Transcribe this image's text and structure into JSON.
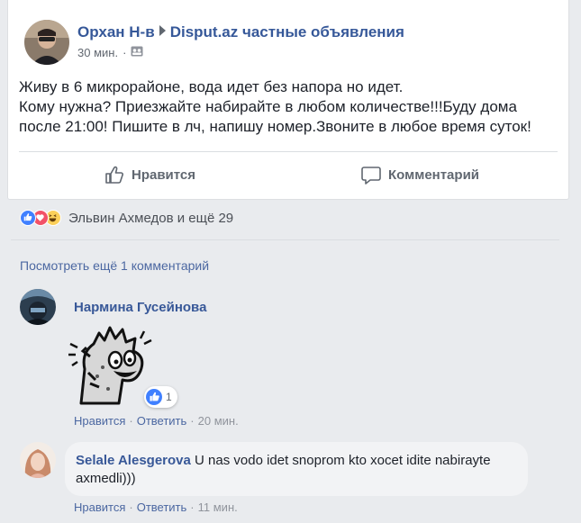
{
  "post": {
    "author": "Орхан Н-в",
    "group": "Disput.az частные объявления",
    "time": "30 мин.",
    "audience_icon": "group-icon",
    "lines": [
      "Живу в 6 микрорайоне, вода идет без напора но идет.",
      "Кому нужна? Приезжайте набирайте в любом количестве!!!Буду дома",
      "после 21:00! Пишите в лч, напишу номер.Звоните в любое время суток!"
    ],
    "like_label": "Нравится",
    "comment_label": "Комментарий"
  },
  "reactions": {
    "icons": [
      "like-reaction-icon",
      "love-reaction-icon",
      "haha-reaction-icon"
    ],
    "summary": "Эльвин Ахмедов и ещё 29"
  },
  "view_more": "Посмотреть ещё 1 комментарий",
  "comments": [
    {
      "author": "Нармина Гусейнова",
      "sticker": "dinosaur-sticker",
      "like_count": "1",
      "like": "Нравится",
      "reply": "Ответить",
      "time": "20 мин."
    },
    {
      "author": "Selale Alesgerova",
      "text": "U nas vodo idet snoprom kto xocet idite nabirayte axmedli)))",
      "like": "Нравится",
      "reply": "Ответить",
      "time": "11 мин."
    }
  ],
  "colors": {
    "link": "#365899",
    "like_blue": "#4080ff",
    "love_red": "#f25268",
    "haha_yellow": "#fcd05a",
    "page_bg": "#e9ebee"
  }
}
